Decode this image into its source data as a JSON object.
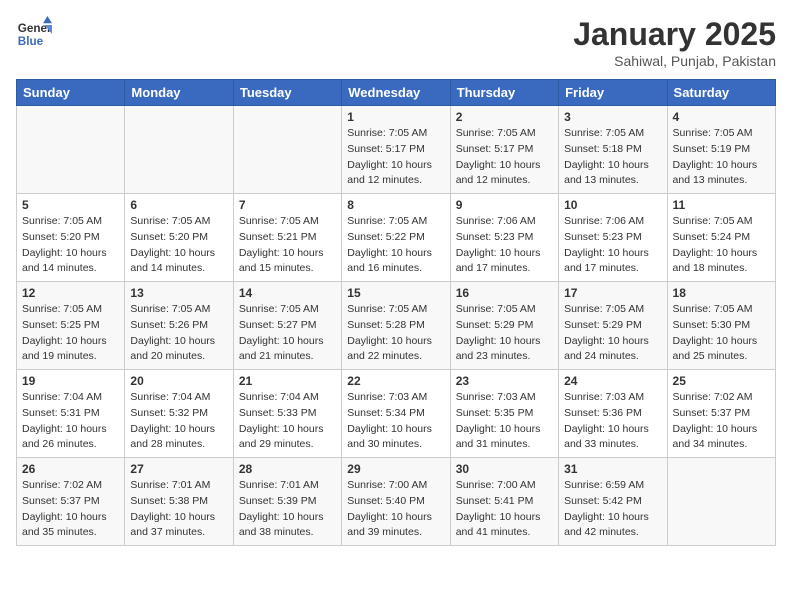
{
  "header": {
    "logo_line1": "General",
    "logo_line2": "Blue",
    "month": "January 2025",
    "location": "Sahiwal, Punjab, Pakistan"
  },
  "weekdays": [
    "Sunday",
    "Monday",
    "Tuesday",
    "Wednesday",
    "Thursday",
    "Friday",
    "Saturday"
  ],
  "weeks": [
    [
      {
        "day": "",
        "info": ""
      },
      {
        "day": "",
        "info": ""
      },
      {
        "day": "",
        "info": ""
      },
      {
        "day": "1",
        "info": "Sunrise: 7:05 AM\nSunset: 5:17 PM\nDaylight: 10 hours\nand 12 minutes."
      },
      {
        "day": "2",
        "info": "Sunrise: 7:05 AM\nSunset: 5:17 PM\nDaylight: 10 hours\nand 12 minutes."
      },
      {
        "day": "3",
        "info": "Sunrise: 7:05 AM\nSunset: 5:18 PM\nDaylight: 10 hours\nand 13 minutes."
      },
      {
        "day": "4",
        "info": "Sunrise: 7:05 AM\nSunset: 5:19 PM\nDaylight: 10 hours\nand 13 minutes."
      }
    ],
    [
      {
        "day": "5",
        "info": "Sunrise: 7:05 AM\nSunset: 5:20 PM\nDaylight: 10 hours\nand 14 minutes."
      },
      {
        "day": "6",
        "info": "Sunrise: 7:05 AM\nSunset: 5:20 PM\nDaylight: 10 hours\nand 14 minutes."
      },
      {
        "day": "7",
        "info": "Sunrise: 7:05 AM\nSunset: 5:21 PM\nDaylight: 10 hours\nand 15 minutes."
      },
      {
        "day": "8",
        "info": "Sunrise: 7:05 AM\nSunset: 5:22 PM\nDaylight: 10 hours\nand 16 minutes."
      },
      {
        "day": "9",
        "info": "Sunrise: 7:06 AM\nSunset: 5:23 PM\nDaylight: 10 hours\nand 17 minutes."
      },
      {
        "day": "10",
        "info": "Sunrise: 7:06 AM\nSunset: 5:23 PM\nDaylight: 10 hours\nand 17 minutes."
      },
      {
        "day": "11",
        "info": "Sunrise: 7:05 AM\nSunset: 5:24 PM\nDaylight: 10 hours\nand 18 minutes."
      }
    ],
    [
      {
        "day": "12",
        "info": "Sunrise: 7:05 AM\nSunset: 5:25 PM\nDaylight: 10 hours\nand 19 minutes."
      },
      {
        "day": "13",
        "info": "Sunrise: 7:05 AM\nSunset: 5:26 PM\nDaylight: 10 hours\nand 20 minutes."
      },
      {
        "day": "14",
        "info": "Sunrise: 7:05 AM\nSunset: 5:27 PM\nDaylight: 10 hours\nand 21 minutes."
      },
      {
        "day": "15",
        "info": "Sunrise: 7:05 AM\nSunset: 5:28 PM\nDaylight: 10 hours\nand 22 minutes."
      },
      {
        "day": "16",
        "info": "Sunrise: 7:05 AM\nSunset: 5:29 PM\nDaylight: 10 hours\nand 23 minutes."
      },
      {
        "day": "17",
        "info": "Sunrise: 7:05 AM\nSunset: 5:29 PM\nDaylight: 10 hours\nand 24 minutes."
      },
      {
        "day": "18",
        "info": "Sunrise: 7:05 AM\nSunset: 5:30 PM\nDaylight: 10 hours\nand 25 minutes."
      }
    ],
    [
      {
        "day": "19",
        "info": "Sunrise: 7:04 AM\nSunset: 5:31 PM\nDaylight: 10 hours\nand 26 minutes."
      },
      {
        "day": "20",
        "info": "Sunrise: 7:04 AM\nSunset: 5:32 PM\nDaylight: 10 hours\nand 28 minutes."
      },
      {
        "day": "21",
        "info": "Sunrise: 7:04 AM\nSunset: 5:33 PM\nDaylight: 10 hours\nand 29 minutes."
      },
      {
        "day": "22",
        "info": "Sunrise: 7:03 AM\nSunset: 5:34 PM\nDaylight: 10 hours\nand 30 minutes."
      },
      {
        "day": "23",
        "info": "Sunrise: 7:03 AM\nSunset: 5:35 PM\nDaylight: 10 hours\nand 31 minutes."
      },
      {
        "day": "24",
        "info": "Sunrise: 7:03 AM\nSunset: 5:36 PM\nDaylight: 10 hours\nand 33 minutes."
      },
      {
        "day": "25",
        "info": "Sunrise: 7:02 AM\nSunset: 5:37 PM\nDaylight: 10 hours\nand 34 minutes."
      }
    ],
    [
      {
        "day": "26",
        "info": "Sunrise: 7:02 AM\nSunset: 5:37 PM\nDaylight: 10 hours\nand 35 minutes."
      },
      {
        "day": "27",
        "info": "Sunrise: 7:01 AM\nSunset: 5:38 PM\nDaylight: 10 hours\nand 37 minutes."
      },
      {
        "day": "28",
        "info": "Sunrise: 7:01 AM\nSunset: 5:39 PM\nDaylight: 10 hours\nand 38 minutes."
      },
      {
        "day": "29",
        "info": "Sunrise: 7:00 AM\nSunset: 5:40 PM\nDaylight: 10 hours\nand 39 minutes."
      },
      {
        "day": "30",
        "info": "Sunrise: 7:00 AM\nSunset: 5:41 PM\nDaylight: 10 hours\nand 41 minutes."
      },
      {
        "day": "31",
        "info": "Sunrise: 6:59 AM\nSunset: 5:42 PM\nDaylight: 10 hours\nand 42 minutes."
      },
      {
        "day": "",
        "info": ""
      }
    ]
  ]
}
